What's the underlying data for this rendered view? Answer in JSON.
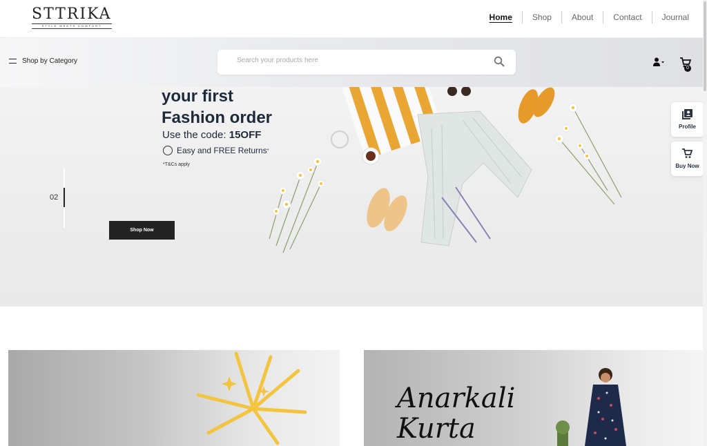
{
  "brand": {
    "name": "STTRIKA",
    "tagline": "STYLE MEETS COMFORT"
  },
  "nav": {
    "items": [
      {
        "label": "Home",
        "active": true
      },
      {
        "label": "Shop",
        "active": false
      },
      {
        "label": "About",
        "active": false
      },
      {
        "label": "Contact",
        "active": false
      },
      {
        "label": "Journal",
        "active": false
      }
    ]
  },
  "subbar": {
    "category_label": "Shop by Category",
    "search_placeholder": "Search your products here",
    "cart_count": "0"
  },
  "hero": {
    "title": "your first\nFashion order",
    "code_prefix": "Use the code: ",
    "code": "15OFF",
    "returns": "Easy and FREE Returns",
    "returns_mark": "*",
    "tc": "*T&Cs apply",
    "slide_number": "02",
    "cta_label": "Shop Now"
  },
  "side_buttons": {
    "profile": "Profile",
    "buy_now": "Buy Now"
  },
  "cards": {
    "right_script": "Anarkali\nKurta"
  },
  "colors": {
    "accent": "#232323",
    "hero_bg": "#ececec",
    "card_gold": "#f2c440"
  }
}
